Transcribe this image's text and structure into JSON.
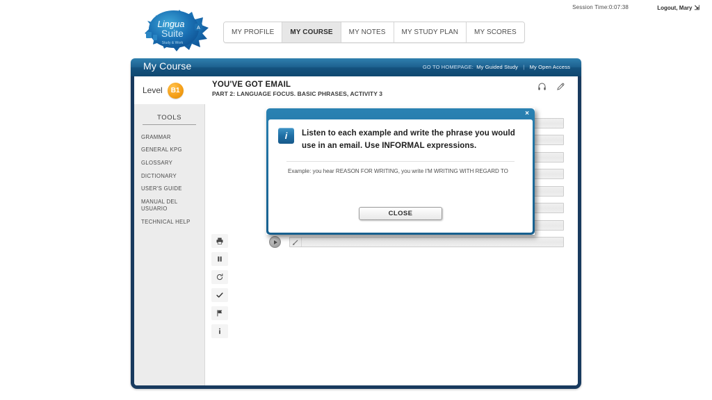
{
  "topbar": {
    "session_time": "Session Time:0:07:38",
    "logout": "Logout, Mary",
    "logout_icon": "logout-arrow-icon",
    "logo_line1": "Lingua",
    "logo_line2": "Suite",
    "logo_tagline": "Study & Work"
  },
  "tabs": [
    {
      "label": "MY PROFILE",
      "active": false
    },
    {
      "label": "MY COURSE",
      "active": true
    },
    {
      "label": "MY NOTES",
      "active": false
    },
    {
      "label": "MY STUDY PLAN",
      "active": false
    },
    {
      "label": "MY SCORES",
      "active": false
    }
  ],
  "frame_header": {
    "title": "My Course",
    "homepage_label": "GO TO HOMEPAGE:",
    "link_guided": "My Guided Study",
    "separator": "|",
    "link_open": "My Open Access"
  },
  "lesson": {
    "level_label": "Level",
    "level_badge": "B1",
    "title": "YOU'VE GOT EMAIL",
    "subtitle": "PART 2: LANGUAGE FOCUS. BASIC PHRASES, ACTIVITY 3",
    "icon_headphones": "headphones-icon",
    "icon_pencil": "pencil-icon"
  },
  "sidebar": {
    "heading": "TOOLS",
    "items": [
      {
        "label": "GRAMMAR"
      },
      {
        "label": "GENERAL KPG"
      },
      {
        "label": "GLOSSARY"
      },
      {
        "label": "DICTIONARY"
      },
      {
        "label": "USER'S GUIDE"
      },
      {
        "label": "MANUAL DEL USUARIO"
      },
      {
        "label": "TECHNICAL HELP"
      }
    ]
  },
  "icon_strip": [
    {
      "name": "print-icon",
      "glyph": "print"
    },
    {
      "name": "pause-icon",
      "glyph": "pause"
    },
    {
      "name": "refresh-icon",
      "glyph": "refresh"
    },
    {
      "name": "check-icon",
      "glyph": "check"
    },
    {
      "name": "flag-icon",
      "glyph": "flag"
    },
    {
      "name": "info-icon",
      "glyph": "info"
    }
  ],
  "exercise": {
    "rows": [
      {
        "index": 1,
        "value": "",
        "placeholder": ""
      },
      {
        "index": 2,
        "value": "",
        "placeholder": ""
      },
      {
        "index": 3,
        "value": "",
        "placeholder": ""
      },
      {
        "index": 4,
        "value": "",
        "placeholder": ""
      },
      {
        "index": 5,
        "value": "",
        "placeholder": ""
      },
      {
        "index": 6,
        "value": "",
        "placeholder": ""
      },
      {
        "index": 7,
        "value": "",
        "placeholder": ""
      },
      {
        "index": 8,
        "value": "",
        "placeholder": ""
      }
    ]
  },
  "modal": {
    "close_x": "×",
    "info_glyph": "i",
    "instruction": "Listen to each example and write the phrase you would use in an email. Use INFORMAL expressions.",
    "example": "Example: you hear REASON FOR WRITING, you write I'M WRITING WITH REGARD TO",
    "close_button": "CLOSE"
  },
  "colors": {
    "frame_navy": "#183a5e",
    "header_blue": "#1d6190",
    "modal_blue": "#1d6e9f",
    "level_orange": "#f5a01a",
    "sidebar_gray": "#ececec"
  }
}
